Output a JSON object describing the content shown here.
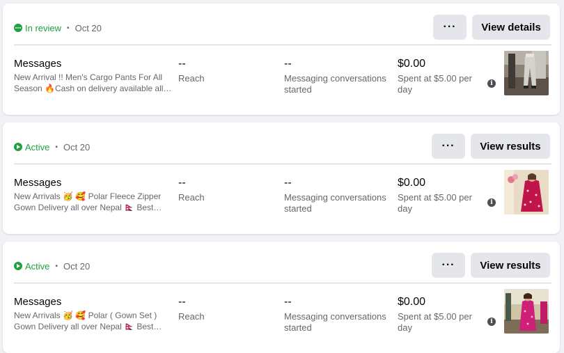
{
  "campaigns": [
    {
      "status": "In review",
      "status_color": "#20a03f",
      "status_icon": "in-review-dots-icon",
      "date": "Oct 20",
      "more_label": "···",
      "action_label": "View details",
      "title": "Messages",
      "description": "New Arrival !! Men's Cargo Pants For All Season 🔥Cash on delivery available all over Nepal",
      "reach_value": "--",
      "reach_label": "Reach",
      "conversations_value": "--",
      "conversations_label": "Messaging conversations started",
      "spent_value": "$0.00",
      "spent_label": "Spent at $5.00 per day",
      "thumbnail": "cargo-pants-photo"
    },
    {
      "status": "Active",
      "status_color": "#20a03f",
      "status_icon": "active-play-icon",
      "date": "Oct 20",
      "more_label": "···",
      "action_label": "View results",
      "title": "Messages",
      "description": "New Arrivals 🥳 🥰 Polar Fleece Zipper Gown Delivery all over Nepal 🇳🇵 Best fabric",
      "reach_value": "--",
      "reach_label": "Reach",
      "conversations_value": "--",
      "conversations_label": "Messaging conversations started",
      "spent_value": "$0.00",
      "spent_label": "Spent at $5.00 per day",
      "thumbnail": "fleece-gown-photo"
    },
    {
      "status": "Active",
      "status_color": "#20a03f",
      "status_icon": "active-play-icon",
      "date": "Oct 20",
      "more_label": "···",
      "action_label": "View results",
      "title": "Messages",
      "description": "New Arrivals 🥳 🥰 Polar ( Gown Set ) Gown Delivery all over Nepal 🇳🇵 Best fabric",
      "reach_value": "--",
      "reach_label": "Reach",
      "conversations_value": "--",
      "conversations_label": "Messaging conversations started",
      "spent_value": "$0.00",
      "spent_label": "Spent at $5.00 per day",
      "thumbnail": "gown-set-photo"
    }
  ]
}
